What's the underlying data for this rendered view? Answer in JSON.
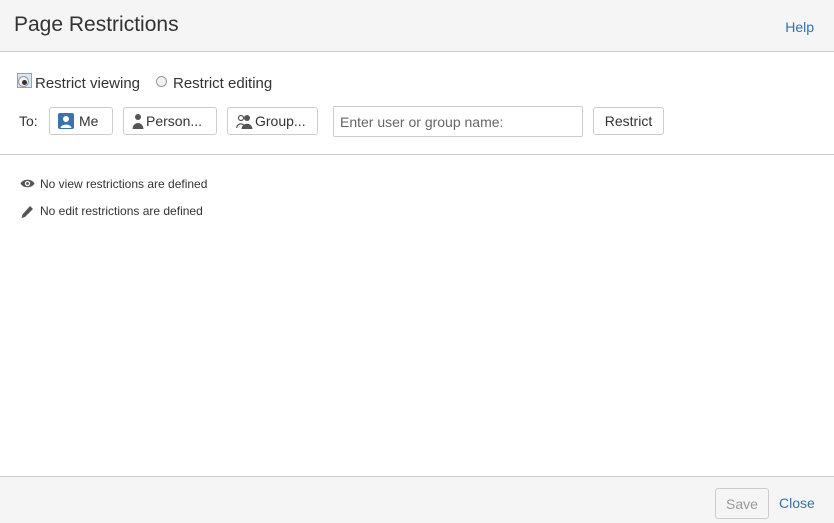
{
  "dialog": {
    "title": "Page Restrictions",
    "help_label": "Help"
  },
  "mode": {
    "options": [
      {
        "label": "Restrict viewing",
        "selected": true
      },
      {
        "label": "Restrict editing",
        "selected": false
      }
    ]
  },
  "to_row": {
    "label": "To:",
    "me_label": "Me",
    "person_label": "Person...",
    "group_label": "Group...",
    "input_placeholder": "Enter user or group name:",
    "input_value": "",
    "restrict_label": "Restrict"
  },
  "status": {
    "view_text": "No view restrictions are defined",
    "edit_text": "No edit restrictions are defined"
  },
  "footer": {
    "save_label": "Save",
    "close_label": "Close"
  },
  "icons": {
    "me": "user-avatar-icon",
    "person": "person-icon",
    "group": "group-icon",
    "view": "eye-icon",
    "edit": "pencil-icon"
  },
  "colors": {
    "link": "#3572b0",
    "me_icon": "#3b73af",
    "header_bg": "#f5f5f5",
    "border": "#cccccc"
  }
}
